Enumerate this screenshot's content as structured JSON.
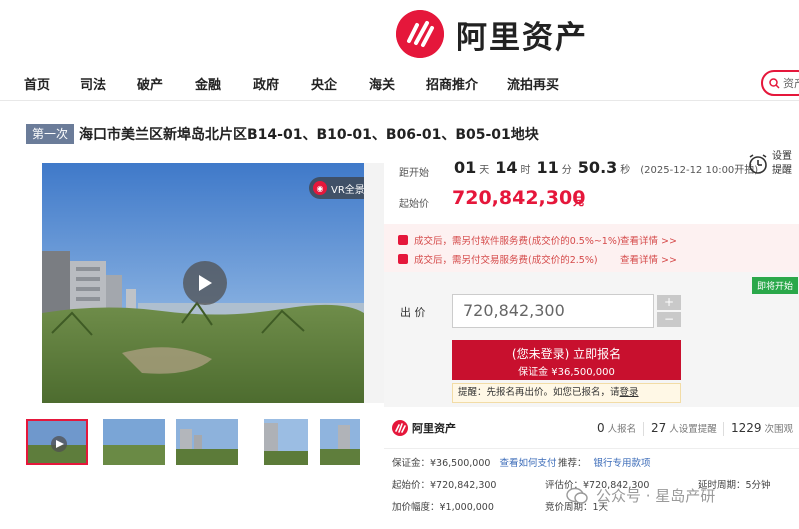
{
  "brand": {
    "name": "阿里资产",
    "accent": "#e5173b"
  },
  "nav": {
    "items": [
      "首页",
      "司法",
      "破产",
      "金融",
      "政府",
      "央企",
      "海关",
      "招商推介",
      "流拍再买"
    ],
    "search_placeholder": "资产"
  },
  "lot": {
    "round": "第一次",
    "title": "海口市美兰区新埠岛北片区B14-01、B10-01、B06-01、B05-01地块"
  },
  "media": {
    "vr_label": "VR全景"
  },
  "countdown": {
    "label": "距开始",
    "days": "01",
    "days_unit": "天",
    "hours": "14",
    "hours_unit": "时",
    "minutes": "11",
    "minutes_unit": "分",
    "seconds": "50.3",
    "seconds_unit": "秒",
    "start_time": "(2025-12-12 10:00开拍)"
  },
  "remind": {
    "line1": "设置",
    "line2": "提醒"
  },
  "start_price": {
    "label": "起始价",
    "value": "720,842,300",
    "unit": "元"
  },
  "notices": [
    {
      "text": "成交后，需另付软件服务费(成交价的0.5%~1%)",
      "link": "查看详情 >>"
    },
    {
      "text": "成交后，需另付交易服务费(成交价的2.5%)",
      "link": "查看详情 >>"
    }
  ],
  "bid": {
    "open_tag": "即将开始",
    "label": "出 价",
    "value": "720,842,300",
    "plus": "+",
    "minus": "−",
    "signup_line1": "(您未登录) 立即报名",
    "signup_line2": "保证金 ¥36,500,000",
    "tip_prefix": "提醒：先报名再出价。如您已报名，请",
    "tip_link": "登录"
  },
  "stats": {
    "logo_text": "阿里资产",
    "signups": "0",
    "signups_unit": "人报名",
    "reminders": "27",
    "reminders_unit": "人设置提醒",
    "views": "1229",
    "views_unit": "次围观"
  },
  "details": {
    "deposit_label": "保证金：¥36,500,000",
    "deposit_link": "查看如何支付",
    "recommend_label": "推荐：",
    "recommend_link": "银行专用款项",
    "start_price": "起始价：¥720,842,300",
    "valuation": "评估价：¥720,842,300",
    "delay": "延时周期：5分钟",
    "increment": "加价幅度：¥1,000,000",
    "period": "竞价周期：1天"
  },
  "watermark": "公众号 · 星岛产研"
}
